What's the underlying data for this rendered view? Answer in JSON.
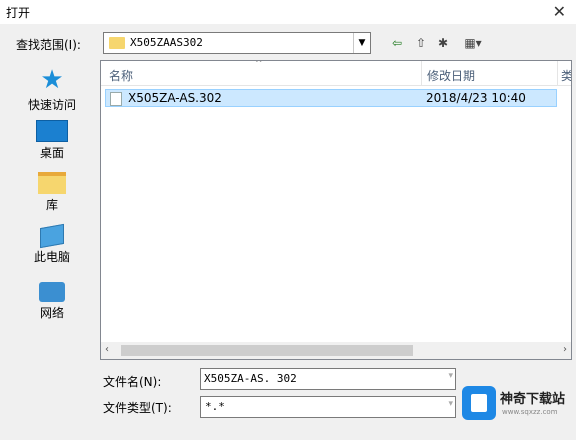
{
  "window": {
    "title": "打开",
    "close_glyph": "✕"
  },
  "toolbar": {
    "lookin_label": "查找范围(I):",
    "lookin_value": "X505ZAAS302",
    "back_glyph": "⇦",
    "up_glyph": "⇧",
    "new_folder_glyph": "✱",
    "view_glyph": "▦▾"
  },
  "places": [
    {
      "label": "快速访问",
      "icon": "star-icon"
    },
    {
      "label": "桌面",
      "icon": "desktop-icon"
    },
    {
      "label": "库",
      "icon": "library-icon"
    },
    {
      "label": "此电脑",
      "icon": "computer-icon"
    },
    {
      "label": "网络",
      "icon": "network-icon"
    }
  ],
  "filelist": {
    "columns": {
      "name": "名称",
      "date": "修改日期",
      "more": "类"
    },
    "rows": [
      {
        "name": "X505ZA-AS.302",
        "date": "2018/4/23 10:40"
      }
    ]
  },
  "footer": {
    "filename_label": "文件名(N):",
    "filename_value": "X505ZA-AS. 302",
    "filetype_label": "文件类型(T):",
    "filetype_value": "*.*"
  },
  "watermark": {
    "title": "神奇下载站",
    "url": "www.sqxzz.com"
  }
}
